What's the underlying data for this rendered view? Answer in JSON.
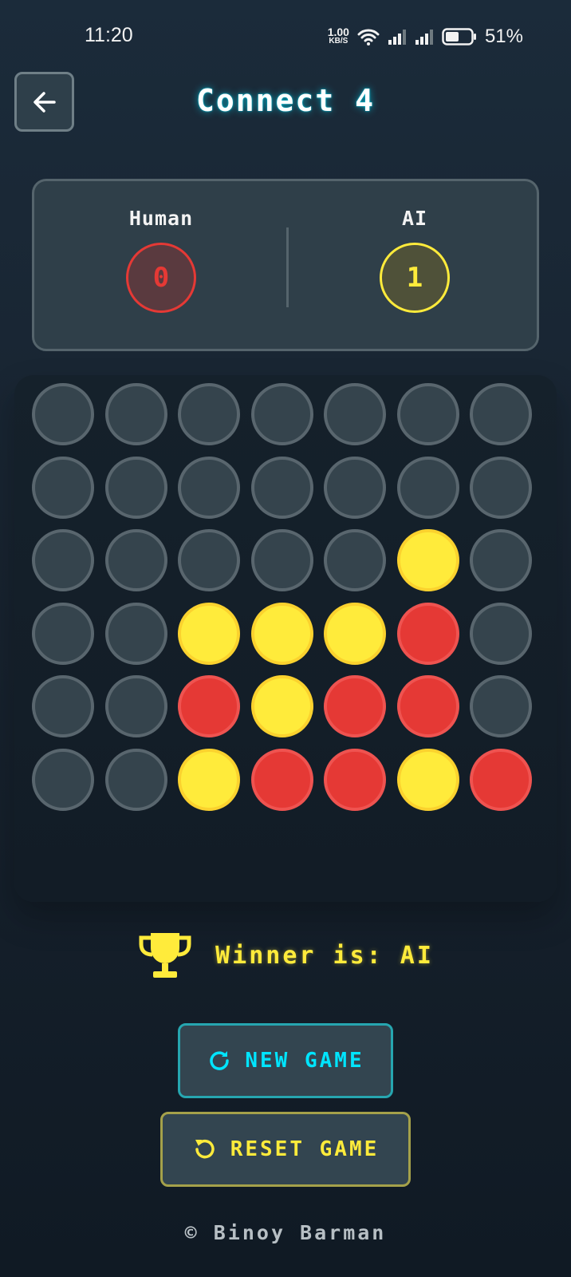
{
  "status_bar": {
    "time": "11:20",
    "net_speed_value": "1.00",
    "net_speed_unit": "KB/S",
    "battery_percent": "51%",
    "icons": [
      "wifi-icon",
      "signal-icon",
      "signal-icon",
      "battery-icon"
    ]
  },
  "header": {
    "title": "Connect 4",
    "back_icon": "arrow-left-icon"
  },
  "score": {
    "human_label": "Human",
    "human_value": "0",
    "ai_label": "AI",
    "ai_value": "1"
  },
  "board": {
    "rows": 6,
    "cols": 7,
    "grid": [
      [
        "empty",
        "empty",
        "empty",
        "empty",
        "empty",
        "empty",
        "empty"
      ],
      [
        "empty",
        "empty",
        "empty",
        "empty",
        "empty",
        "empty",
        "empty"
      ],
      [
        "empty",
        "empty",
        "empty",
        "empty",
        "empty",
        "yellow",
        "empty"
      ],
      [
        "empty",
        "empty",
        "yellow",
        "yellow",
        "yellow",
        "red",
        "empty"
      ],
      [
        "empty",
        "empty",
        "red",
        "yellow",
        "red",
        "red",
        "empty"
      ],
      [
        "empty",
        "empty",
        "yellow",
        "red",
        "red",
        "yellow",
        "red"
      ]
    ]
  },
  "winner": {
    "text": "Winner is: AI",
    "icon": "trophy-icon"
  },
  "buttons": {
    "new_game": "NEW GAME",
    "reset_game": "RESET GAME"
  },
  "footer": {
    "text": "© Binoy Barman"
  },
  "colors": {
    "red": "#e53935",
    "yellow": "#ffeb3b",
    "cyan": "#00e5ff",
    "empty": "#35444d"
  }
}
